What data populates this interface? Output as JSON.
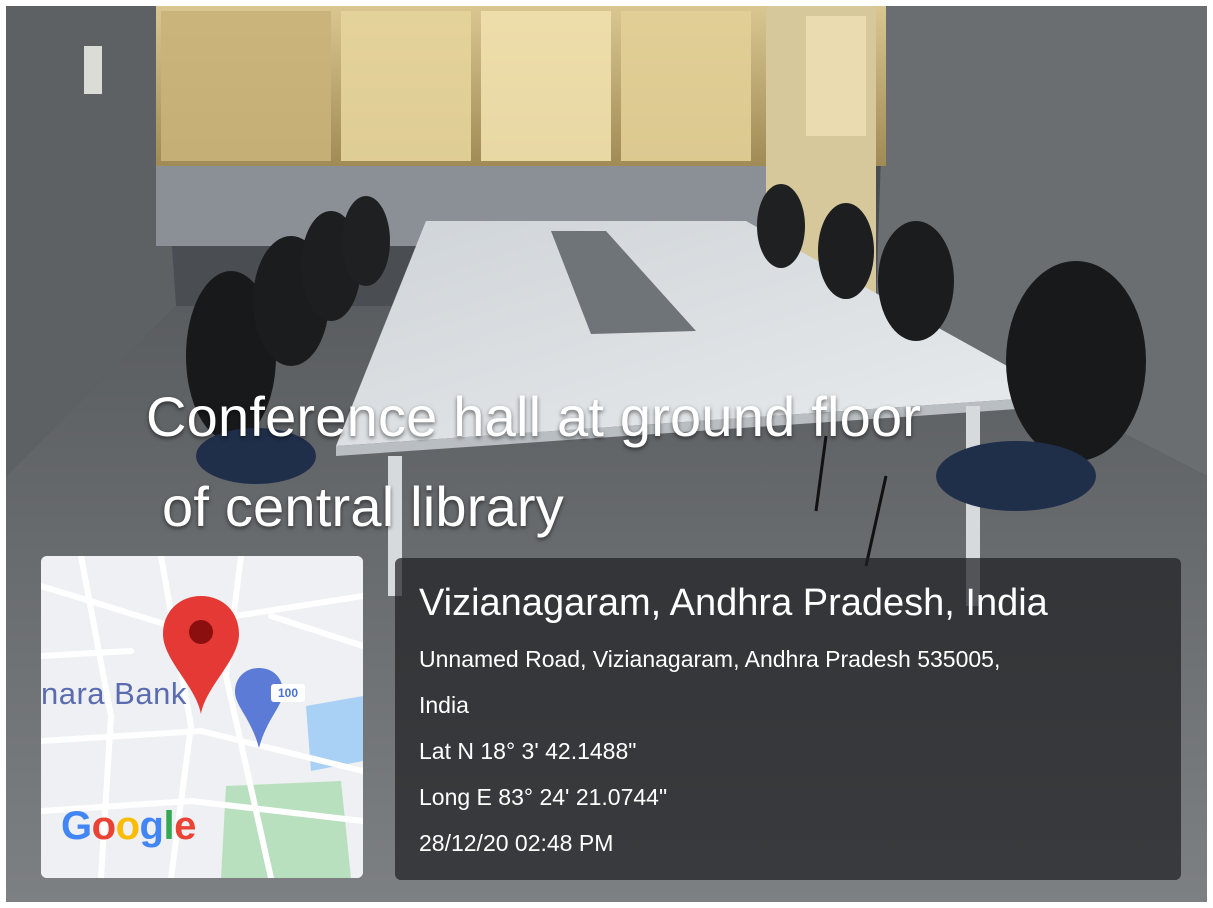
{
  "caption": {
    "line1": "Conference hall at ground floor",
    "line2": "of central library"
  },
  "map": {
    "bank_label": "nara Bank",
    "poi_badge": "100",
    "logo_letters": [
      {
        "ch": "G",
        "color": "#4285F4"
      },
      {
        "ch": "o",
        "color": "#EA4335"
      },
      {
        "ch": "o",
        "color": "#FBBC05"
      },
      {
        "ch": "g",
        "color": "#4285F4"
      },
      {
        "ch": "l",
        "color": "#34A853"
      },
      {
        "ch": "e",
        "color": "#EA4335"
      }
    ],
    "pin_color": "#E53935",
    "poi_color": "#5B7BD6",
    "water_color": "#A9D1F5",
    "park_color": "#B9E0BE"
  },
  "location": {
    "city_line": "Vizianagaram, Andhra Pradesh, India",
    "address_line1": "Unnamed Road, Vizianagaram, Andhra Pradesh 535005,",
    "address_line2": "India",
    "lat": "Lat N 18° 3' 42.1488\"",
    "long": "Long E 83° 24' 21.0744\"",
    "datetime": "28/12/20 02:48 PM"
  }
}
